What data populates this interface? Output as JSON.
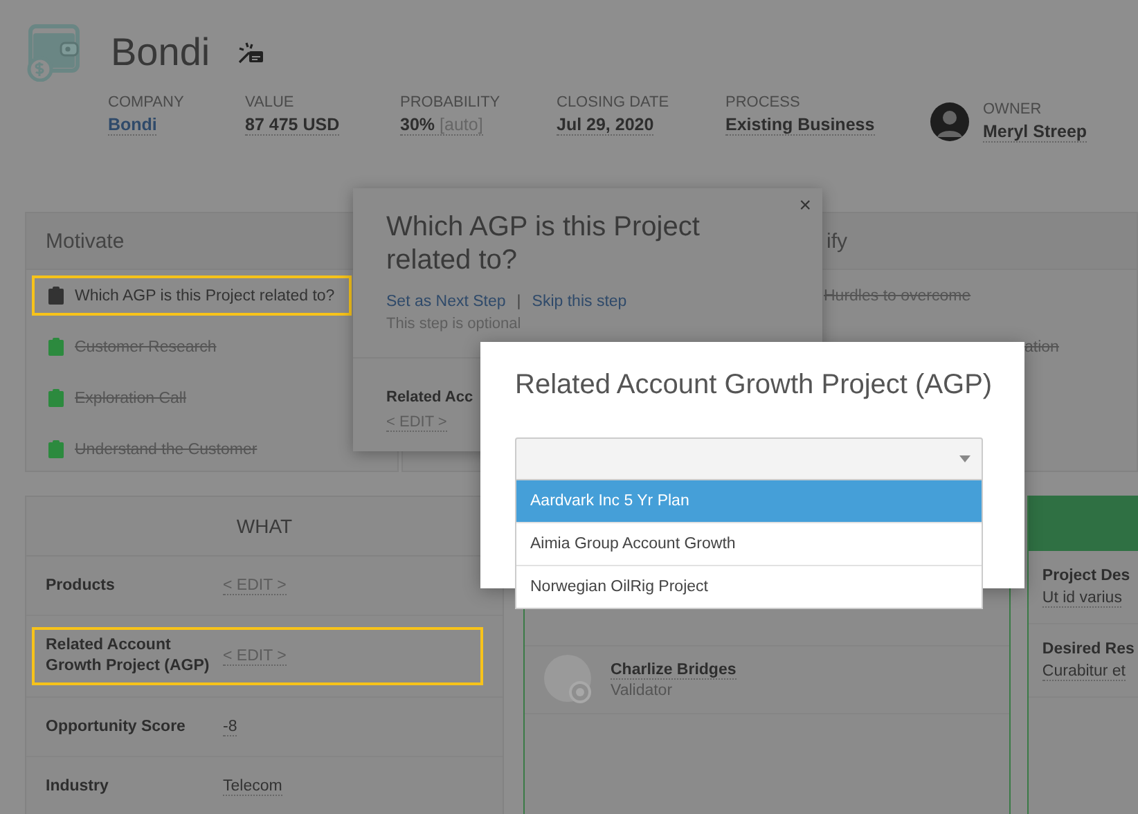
{
  "deal": {
    "title": "Bondi"
  },
  "meta": [
    {
      "label": "COMPANY",
      "value": "Bondi",
      "kind": "link"
    },
    {
      "label": "VALUE",
      "value": "87 475 USD",
      "kind": "text"
    },
    {
      "label": "PROBABILITY",
      "value": "30%",
      "note": "[auto]",
      "kind": "text"
    },
    {
      "label": "CLOSING DATE",
      "value": "Jul 29, 2020",
      "kind": "text"
    },
    {
      "label": "PROCESS",
      "value": "Existing Business",
      "kind": "text"
    },
    {
      "label": "OWNER",
      "value": "Meryl Streep",
      "kind": "owner"
    }
  ],
  "motivate": {
    "title": "Motivate",
    "steps": [
      {
        "label": "Which AGP is this Project related to?",
        "done": false,
        "highlighted": true
      },
      {
        "label": "Customer Research",
        "done": true,
        "highlighted": false
      },
      {
        "label": "Exploration Call",
        "done": true,
        "highlighted": false
      },
      {
        "label": "Understand the Customer",
        "done": true,
        "highlighted": false
      }
    ]
  },
  "qualify": {
    "title": "ify",
    "steps": [
      {
        "label": "Hurdles to overcome",
        "done": true
      },
      {
        "label": "ation",
        "done": true
      }
    ]
  },
  "what": {
    "title": "WHAT",
    "fields": [
      {
        "label": "Products",
        "value": "< EDIT >",
        "kind": "edit",
        "highlighted": false
      },
      {
        "label": "Related Account Growth Project (AGP)",
        "value": "< EDIT >",
        "kind": "edit",
        "highlighted": true
      },
      {
        "label": "Opportunity Score",
        "value": "-8",
        "kind": "value",
        "highlighted": false
      },
      {
        "label": "Industry",
        "value": "Telecom",
        "kind": "value",
        "highlighted": false
      }
    ]
  },
  "people": [
    {
      "name": "Charlize Bridges",
      "role": "Validator"
    }
  ],
  "details": {
    "fields": [
      {
        "label": "Project Des",
        "value": "Ut id varius"
      },
      {
        "label": "Desired Res",
        "value": "Curabitur et"
      }
    ]
  },
  "popover": {
    "title": "Which AGP is this Project related to?",
    "close": "×",
    "actions": [
      "Set as Next Step",
      "Skip this step"
    ],
    "separator": "|",
    "note": "This step is optional",
    "field_label": "Related Acc",
    "field_value": "< EDIT >"
  },
  "modal": {
    "title": "Related Account Growth Project (AGP)",
    "options": [
      {
        "label": "Aardvark Inc 5 Yr Plan",
        "selected": true
      },
      {
        "label": "Aimia Group Account Growth",
        "selected": false
      },
      {
        "label": "Norwegian OilRig Project",
        "selected": false
      }
    ]
  }
}
